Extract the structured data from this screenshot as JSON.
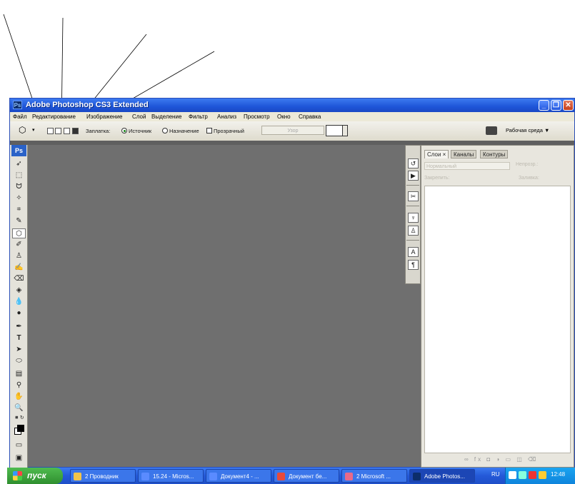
{
  "window": {
    "title": "Adobe Photoshop CS3 Extended",
    "app_badge": "Ps"
  },
  "menu": [
    "Файл",
    "Редактирование",
    "Изображение",
    "Слой",
    "Выделение",
    "Фильтр",
    "Анализ",
    "Просмотр",
    "Окно",
    "Справка"
  ],
  "options": {
    "patch_label": "Заплатка:",
    "source_label": "Источник",
    "destination_label": "Назначение",
    "transparent_label": "Прозрачный",
    "pattern_button": "Узор",
    "workspace_label": "Рабочая среда ▼"
  },
  "toolbox": {
    "badge": "Ps"
  },
  "layers_panel": {
    "tabs": [
      "Слои ×",
      "Каналы",
      "Контуры"
    ],
    "blend_mode": "Нормальный",
    "opacity_label": "Непрозр.:",
    "lock_label": "Закрепить:",
    "fill_label": "Заливка:",
    "footer_icons": "∞ fx ◘ ◑ ▭ ◫ ⌫"
  },
  "taskbar": {
    "start_label": "пуск",
    "tasks": [
      "2 Проводник",
      "15.24 - Micros...",
      "Документ4 - ...",
      "Документ бе...",
      "2 Microsoft ...",
      "Adobe Photos..."
    ],
    "language": "RU",
    "clock": "12:48"
  },
  "colors": {
    "title_blue": "#1e55d8",
    "canvas_gray": "#6f6f6f",
    "start_green": "#2f8f2f"
  }
}
